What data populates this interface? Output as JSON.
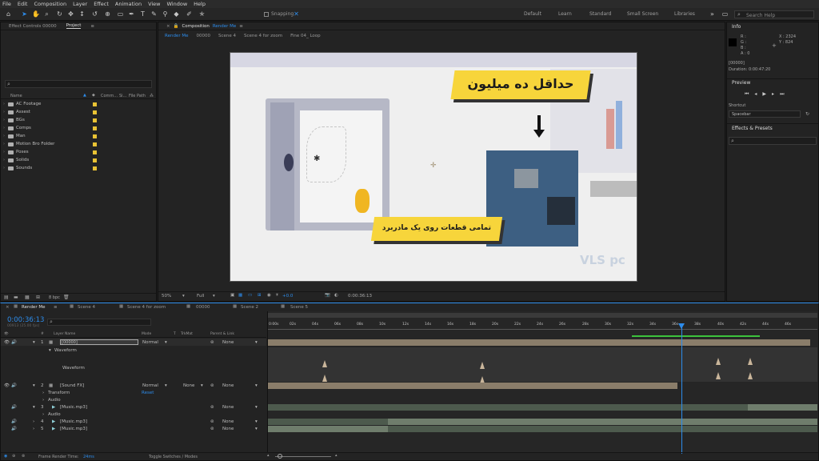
{
  "menu": [
    "File",
    "Edit",
    "Composition",
    "Layer",
    "Effect",
    "Animation",
    "View",
    "Window",
    "Help"
  ],
  "toolbar": {
    "snapping_label": "Snapping",
    "workspaces": [
      "Default",
      "Learn",
      "Standard",
      "Small Screen",
      "Libraries"
    ],
    "search_placeholder": "Search Help"
  },
  "left_panel": {
    "tabs": [
      "Effect Controls 00000",
      "Project"
    ],
    "columns": [
      "Name",
      "Comm...",
      "Si...",
      "File Path"
    ],
    "folders": [
      "AC Footage",
      "Assest",
      "BGs",
      "Comps",
      "Man",
      "Motion Bro Folder",
      "Poses",
      "Solids",
      "Sounds"
    ],
    "footer_bpc": "8 bpc"
  },
  "composition": {
    "tab_label": "Composition",
    "tab_name": "Render Me",
    "breadcrumbs": [
      "Render Me",
      "00000",
      "Scene 4",
      "Scene 4 for zoom",
      "Fine 04_ Loop"
    ],
    "title_text": "حداقل ده میلیون",
    "caption_text": "تمامی قطعات روی یک مادربرد",
    "watermark": "VLS pc",
    "zoom": "50%",
    "resolution": "Full",
    "exposure": "+0.0",
    "timecode": "0:00:36:13"
  },
  "right_panel": {
    "info_title": "Info",
    "rgba": [
      "R :",
      "G :",
      "B :",
      "A : 0"
    ],
    "x": "X : 2324",
    "y": "Y : 824",
    "comp_id": "[00000]",
    "duration": "Duration: 0:00:47:20",
    "preview_title": "Preview",
    "shortcut_label": "Shortcut",
    "shortcut_value": "Spacebar",
    "effects_title": "Effects & Presets"
  },
  "timeline": {
    "tabs": [
      "Render Me",
      "Scene 4",
      "Scene 4 for zoom",
      "00000",
      "Scene 2",
      "Scene 5"
    ],
    "current_time": "0:00:36:13",
    "frame_info": "00913 (25.00 fps)",
    "headers": [
      "#",
      "Layer Name",
      "Mode",
      "T",
      "TrkMat",
      "Parent & Link"
    ],
    "ruler": [
      "0:00s",
      "02s",
      "04s",
      "06s",
      "08s",
      "10s",
      "12s",
      "14s",
      "16s",
      "18s",
      "20s",
      "22s",
      "24s",
      "26s",
      "28s",
      "30s",
      "32s",
      "34s",
      "36s",
      "38s",
      "40s",
      "42s",
      "44s",
      "46s"
    ],
    "layers": [
      {
        "num": "1",
        "name": "[00000]",
        "mode": "Normal",
        "trkmat": "",
        "parent": "None"
      },
      {
        "num": "2",
        "name": "[Sound FX]",
        "mode": "Normal",
        "trkmat": "None",
        "parent": "None"
      },
      {
        "num": "3",
        "name": "[Music.mp3]",
        "mode": "",
        "trkmat": "",
        "parent": "None"
      },
      {
        "num": "4",
        "name": "[Music.mp3]",
        "mode": "",
        "trkmat": "",
        "parent": "None"
      },
      {
        "num": "5",
        "name": "[Music.mp3]",
        "mode": "",
        "trkmat": "",
        "parent": "None"
      }
    ],
    "sub_waveform": "Waveform",
    "sub_waveform_2": "Waveform",
    "sub_transform": "Transform",
    "reset": "Reset",
    "sub_audio": "Audio",
    "sub_audio_2": "Audio",
    "render_time_label": "Frame Render Time:",
    "render_time_value": "24ms",
    "toggle_label": "Toggle Switches / Modes"
  },
  "colors": {
    "accent": "#2d8ceb",
    "label_yellow": "#e8c234",
    "bar_tan": "#8a7d6a",
    "bar_green": "#6f7d6c"
  }
}
